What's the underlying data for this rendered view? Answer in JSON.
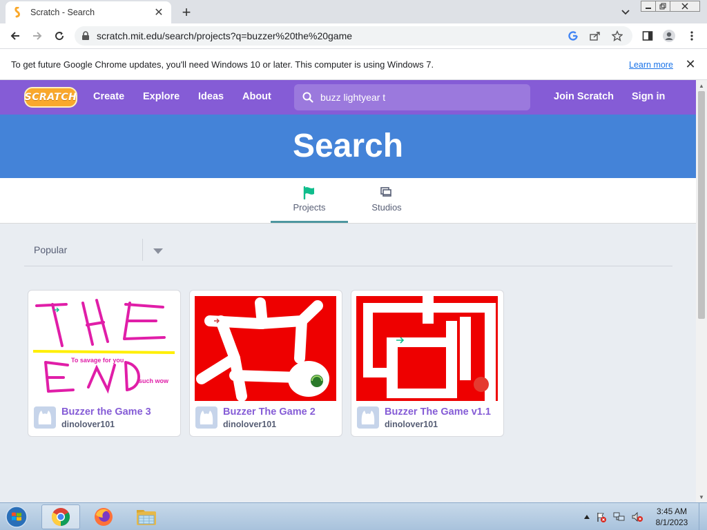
{
  "browser": {
    "tab_title": "Scratch - Search",
    "url": "scratch.mit.edu/search/projects?q=buzzer%20the%20game",
    "newtab_symbol": "+",
    "close_symbol": "✕"
  },
  "infobar": {
    "message": "To get future Google Chrome updates, you'll need Windows 10 or later. This computer is using Windows 7.",
    "learn_more": "Learn more",
    "dismiss_symbol": "✕"
  },
  "scratch_nav": {
    "logo_text": "SCRATCH",
    "links": [
      "Create",
      "Explore",
      "Ideas",
      "About"
    ],
    "search_value": "buzz lightyear t",
    "join": "Join Scratch",
    "signin": "Sign in"
  },
  "banner": {
    "title": "Search"
  },
  "tabs": [
    {
      "label": "Projects",
      "icon": "flag-icon",
      "active": true
    },
    {
      "label": "Studios",
      "icon": "studios-icon",
      "active": false
    }
  ],
  "sort": {
    "selected": "Popular"
  },
  "projects": [
    {
      "title": "Buzzer the Game 3",
      "author": "dinolover101"
    },
    {
      "title": "Buzzer The Game 2",
      "author": "dinolover101"
    },
    {
      "title": "Buzzer The Game v1.1",
      "author": "dinolover101"
    }
  ],
  "thumb_text": {
    "savage": "To savage for you",
    "wow": "such wow"
  },
  "taskbar": {
    "time": "3:45 AM",
    "date": "8/1/2023"
  },
  "colors": {
    "scratch_purple": "#855cd6",
    "banner_blue": "#4483d8",
    "chrome_blue": "#1a73e8"
  }
}
